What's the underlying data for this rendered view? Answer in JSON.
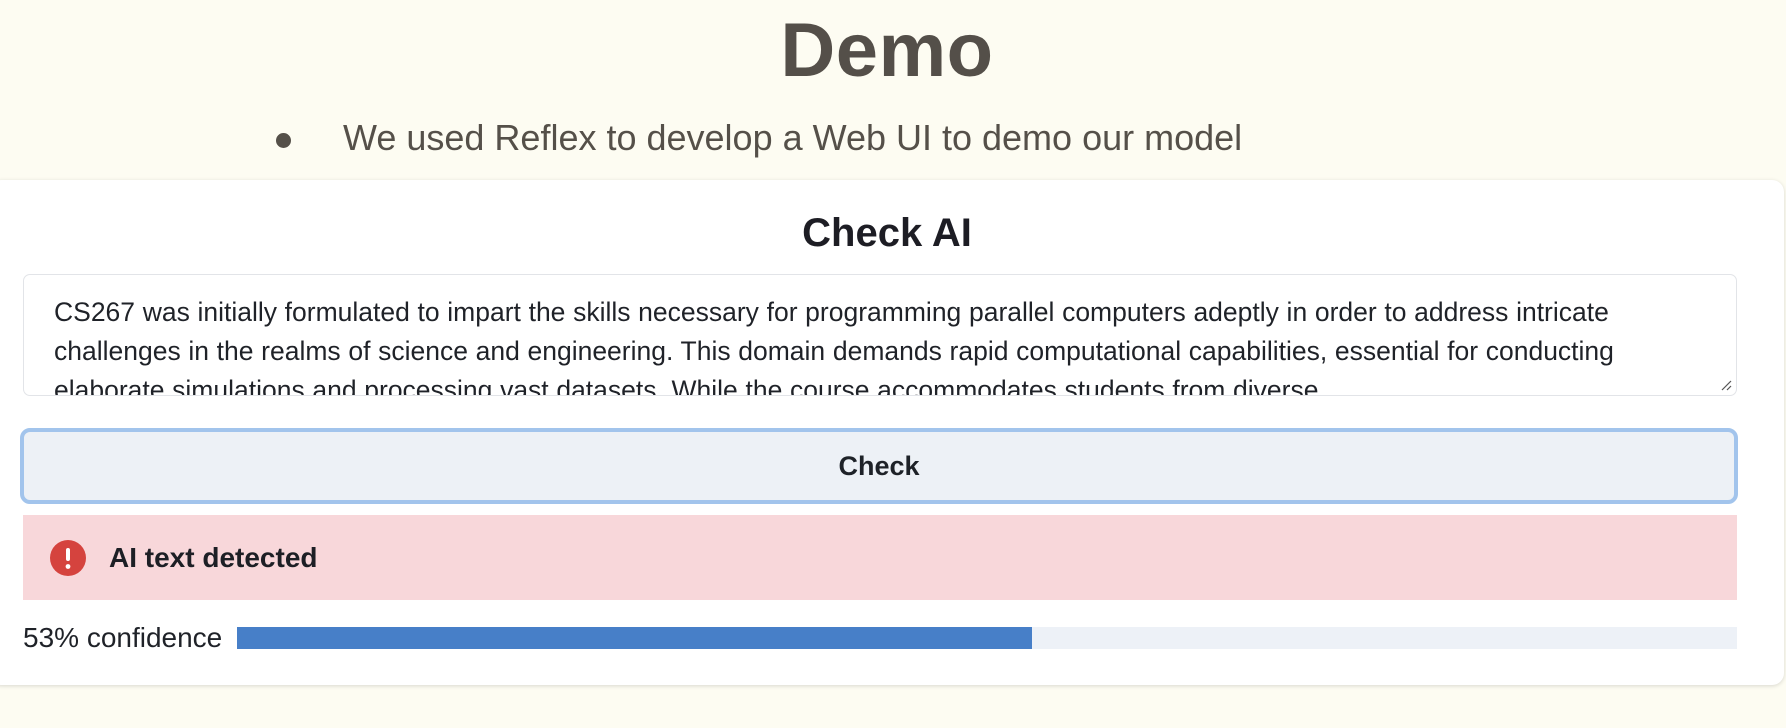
{
  "slide": {
    "title": "Demo",
    "bullets": [
      "We used Reflex to develop a Web UI to demo our model"
    ]
  },
  "app": {
    "title": "Check AI",
    "input_text": "CS267 was initially formulated to impart the skills necessary for programming parallel computers adeptly in order to address intricate challenges in the realms of science and engineering. This domain demands rapid computational capabilities, essential for conducting elaborate simulations and processing vast datasets. While the course accommodates students from diverse",
    "check_button_label": "Check",
    "alert": {
      "icon": "exclamation-circle-icon",
      "text": "AI text detected",
      "color": "#d5433e"
    },
    "confidence": {
      "label": "53% confidence",
      "value": 0.53
    }
  },
  "colors": {
    "background": "#fdfcf2",
    "accent": "#477fc8",
    "alert_background": "#f8d7da",
    "button_focus": "#a2c4ec"
  }
}
